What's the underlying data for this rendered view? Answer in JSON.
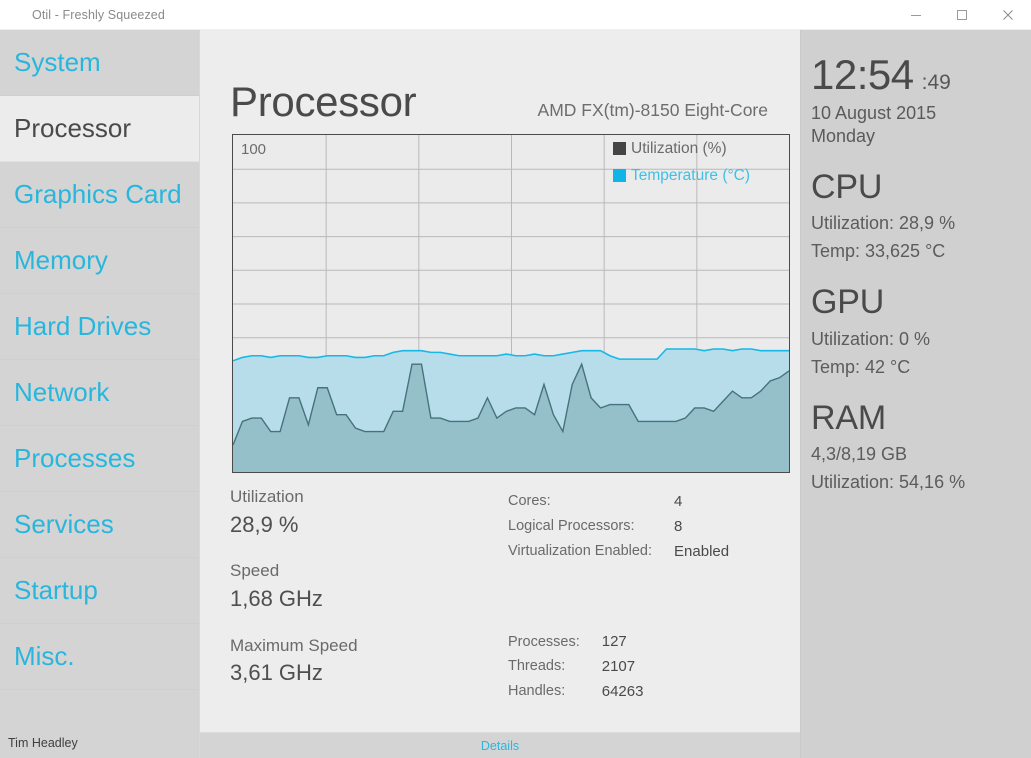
{
  "window": {
    "title": "Otil - Freshly Squeezed",
    "minimize_label": "Minimize",
    "maximize_label": "Maximize",
    "close_label": "Close"
  },
  "sidebar": {
    "items": [
      {
        "label": "System",
        "active": false
      },
      {
        "label": "Processor",
        "active": true
      },
      {
        "label": "Graphics Card",
        "active": false
      },
      {
        "label": "Memory",
        "active": false
      },
      {
        "label": "Hard Drives",
        "active": false
      },
      {
        "label": "Network",
        "active": false
      },
      {
        "label": "Processes",
        "active": false
      },
      {
        "label": "Services",
        "active": false
      },
      {
        "label": "Startup",
        "active": false
      },
      {
        "label": "Misc.",
        "active": false
      }
    ],
    "footer_user": "Tim Headley"
  },
  "main": {
    "title": "Processor",
    "subtitle": "AMD FX(tm)-8150 Eight-Core",
    "y_max_label": "100",
    "stats_left": [
      {
        "label": "Utilization",
        "value": "28,9 %"
      },
      {
        "label": "Speed",
        "value": "1,68 GHz"
      },
      {
        "label": "Maximum Speed",
        "value": "3,61 GHz"
      }
    ],
    "specs": [
      {
        "key": "Cores:",
        "value": "4"
      },
      {
        "key": "Logical Processors:",
        "value": "8"
      },
      {
        "key": "Virtualization Enabled:",
        "value": "Enabled"
      }
    ],
    "counters": [
      {
        "key": "Processes:",
        "value": "127"
      },
      {
        "key": "Threads:",
        "value": "2107"
      },
      {
        "key": "Handles:",
        "value": "64263"
      }
    ]
  },
  "footer": {
    "details_label": "Details"
  },
  "right_panel": {
    "clock_time": "12:54",
    "clock_seconds": ":49",
    "date": "10 August 2015",
    "weekday": "Monday",
    "sections": [
      {
        "title": "CPU",
        "lines": [
          "Utilization: 28,9 %",
          "Temp: 33,625 °C"
        ]
      },
      {
        "title": "GPU",
        "lines": [
          "Utilization: 0 %",
          "Temp: 42 °C"
        ]
      },
      {
        "title": "RAM",
        "lines": [
          "4,3/8,19 GB",
          "Utilization: 54,16 %"
        ]
      }
    ]
  },
  "colors": {
    "accent_cyan": "#29b6dd",
    "utilization_line": "#4a7a85",
    "utilization_fill": "#8fbcc4",
    "temperature_line": "#17b8e8",
    "temperature_fill": "#b6dde9",
    "legend_utilization_swatch": "#444444",
    "legend_temperature_swatch": "#11b4e6",
    "text_dark": "#4a4a4a",
    "sidebar_bg": "#d4d4d4",
    "panel_bg": "#d0d0d0"
  },
  "chart_data": {
    "type": "area",
    "title": "",
    "xlabel": "",
    "ylabel": "",
    "ylim": [
      0,
      100
    ],
    "xlim": [
      0,
      60
    ],
    "grid": true,
    "grid_rows": 10,
    "grid_cols": 6,
    "legend_position": "top-right",
    "series": [
      {
        "name": "Utilization (%)",
        "color": "#4a7a85",
        "fill": "#8fbcc4",
        "values": [
          8,
          15,
          16,
          16,
          12,
          12,
          22,
          22,
          14,
          25,
          25,
          17,
          17,
          13,
          12,
          12,
          12,
          18,
          18,
          32,
          32,
          16,
          16,
          15,
          15,
          15,
          16,
          22,
          16,
          18,
          19,
          19,
          17,
          26,
          17,
          12,
          26,
          32,
          22,
          19,
          20,
          20,
          20,
          15,
          15,
          15,
          15,
          15,
          16,
          19,
          19,
          18,
          21,
          24,
          22,
          22,
          24,
          27,
          28,
          30
        ]
      },
      {
        "name": "Temperature (°C)",
        "color": "#17b8e8",
        "fill": "#b6dde9",
        "values": [
          33,
          34,
          34.5,
          34.5,
          34,
          34.5,
          34.5,
          34.5,
          34,
          34,
          34.5,
          34.5,
          34.5,
          34,
          34,
          34.5,
          34.5,
          35.5,
          36,
          36,
          36,
          35.5,
          35.5,
          35,
          34.5,
          34.5,
          34.5,
          34.5,
          34.5,
          35,
          34.5,
          34.5,
          35,
          34.5,
          34.5,
          35,
          35.5,
          36,
          36,
          36,
          34.5,
          33.5,
          33.5,
          33.5,
          33.5,
          33.5,
          36.5,
          36.5,
          36.5,
          36.5,
          36,
          36.5,
          36.5,
          36,
          36.5,
          36.5,
          36,
          36,
          36,
          36
        ]
      }
    ]
  }
}
